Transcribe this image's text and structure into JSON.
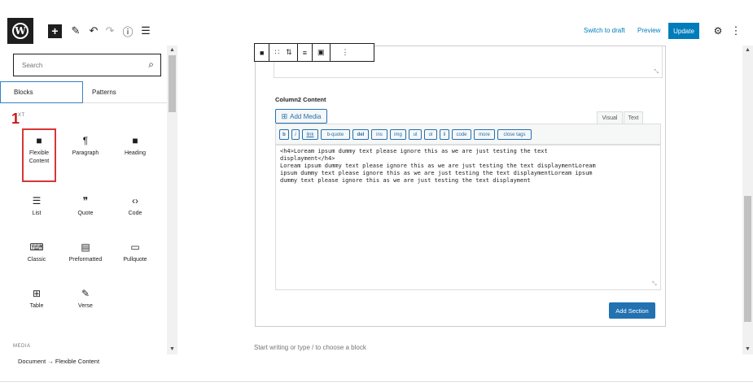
{
  "topbar": {
    "logo_glyph": "W",
    "add_glyph": "+",
    "edit_glyph": "✎",
    "undo_glyph": "↶",
    "redo_glyph": "↷",
    "info_glyph": "ⓘ",
    "list_glyph": "☰",
    "switch_to_draft": "Switch to draft",
    "preview": "Preview",
    "update": "Update",
    "settings_glyph": "⚙",
    "more_glyph": "⋮"
  },
  "inserter": {
    "search_placeholder": "Search",
    "search_glyph": "⌕",
    "tab_blocks": "Blocks",
    "tab_patterns": "Patterns",
    "annotation_number": "1",
    "category_text": "XT",
    "media_category": "MEDIA",
    "blocks": [
      {
        "label": "Flexible\nContent",
        "icon": "■"
      },
      {
        "label": "Paragraph",
        "icon": "¶"
      },
      {
        "label": "Heading",
        "icon": "■"
      },
      {
        "label": "List",
        "icon": "☰"
      },
      {
        "label": "Quote",
        "icon": "❞"
      },
      {
        "label": "Code",
        "icon": "‹›"
      },
      {
        "label": "Classic",
        "icon": "⌨"
      },
      {
        "label": "Preformatted",
        "icon": "▤"
      },
      {
        "label": "Pullquote",
        "icon": "▭"
      },
      {
        "label": "Table",
        "icon": "⊞"
      },
      {
        "label": "Verse",
        "icon": "✎"
      }
    ]
  },
  "block_toolbar": {
    "block_glyph": "■",
    "drag_glyph": "∷",
    "move_glyph": "⇅",
    "align_glyph": "≡",
    "layout_glyph": "▣",
    "more_glyph": "⋮"
  },
  "editor": {
    "field_label": "Column2 Content",
    "add_media": "Add Media",
    "add_media_glyph": "⊞",
    "tab_visual": "Visual",
    "tab_text": "Text",
    "quicktags": [
      "b",
      "i",
      "link",
      "b-quote",
      "del",
      "ins",
      "img",
      "ul",
      "ol",
      "li",
      "code",
      "more",
      "close tags"
    ],
    "content": "<h4>Loream ipsum dummy text please ignore this as we are just testing the text\ndisplayment</h4>\nLoream ipsum dummy text please ignore this as we are just testing the text displaymentLoream\nipsum dummy text please ignore this as we are just testing the text displaymentLoream ipsum\ndummy text please ignore this as we are just testing the text displayment",
    "add_section": "Add Section",
    "placeholder": "Start writing or type / to choose a block",
    "grip_glyph": "⤡"
  },
  "footer": {
    "breadcrumb": "Document  →  Flexible Content"
  },
  "colors": {
    "accent": "#007cba",
    "highlight": "#d63638"
  }
}
